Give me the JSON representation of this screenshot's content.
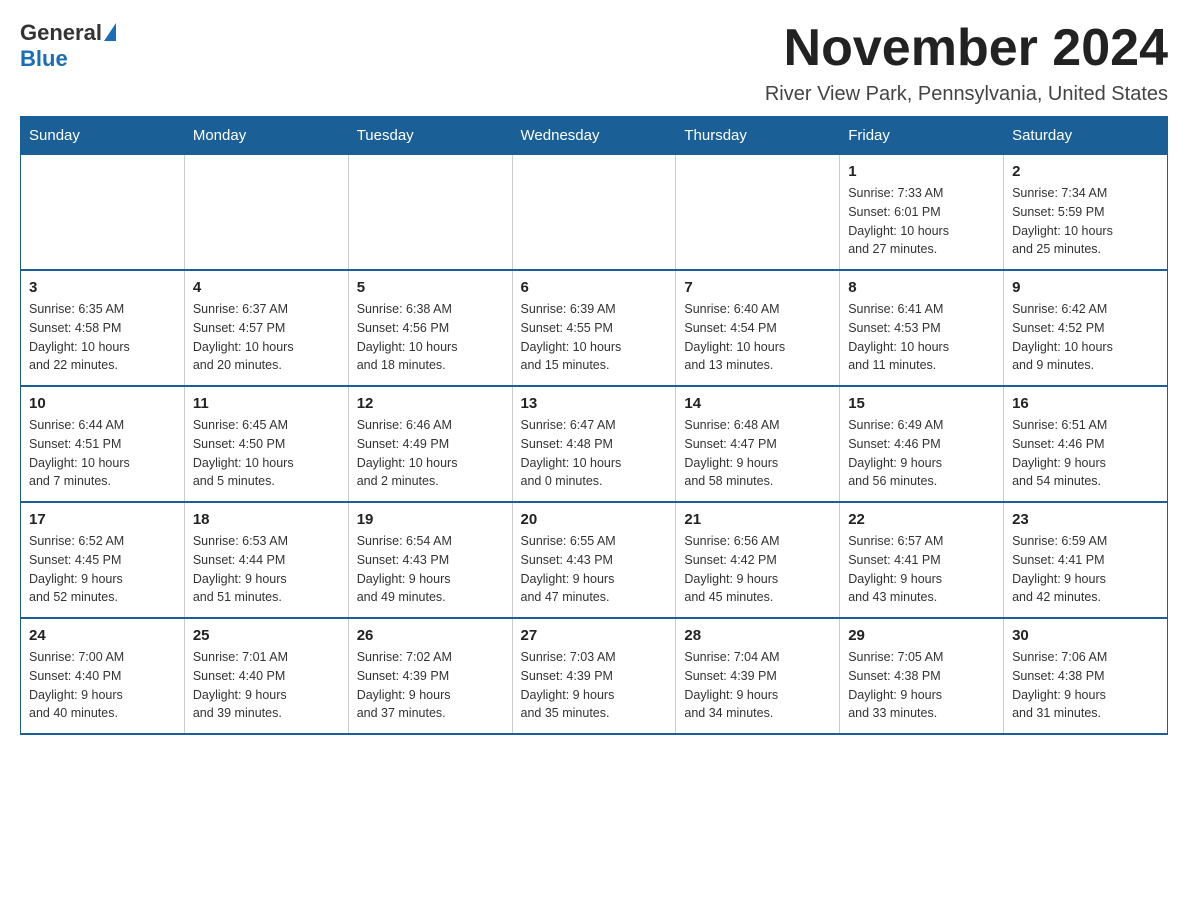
{
  "header": {
    "logo_general": "General",
    "logo_blue": "Blue",
    "title": "November 2024",
    "subtitle": "River View Park, Pennsylvania, United States"
  },
  "weekdays": [
    "Sunday",
    "Monday",
    "Tuesday",
    "Wednesday",
    "Thursday",
    "Friday",
    "Saturday"
  ],
  "weeks": [
    [
      {
        "day": "",
        "info": ""
      },
      {
        "day": "",
        "info": ""
      },
      {
        "day": "",
        "info": ""
      },
      {
        "day": "",
        "info": ""
      },
      {
        "day": "",
        "info": ""
      },
      {
        "day": "1",
        "info": "Sunrise: 7:33 AM\nSunset: 6:01 PM\nDaylight: 10 hours\nand 27 minutes."
      },
      {
        "day": "2",
        "info": "Sunrise: 7:34 AM\nSunset: 5:59 PM\nDaylight: 10 hours\nand 25 minutes."
      }
    ],
    [
      {
        "day": "3",
        "info": "Sunrise: 6:35 AM\nSunset: 4:58 PM\nDaylight: 10 hours\nand 22 minutes."
      },
      {
        "day": "4",
        "info": "Sunrise: 6:37 AM\nSunset: 4:57 PM\nDaylight: 10 hours\nand 20 minutes."
      },
      {
        "day": "5",
        "info": "Sunrise: 6:38 AM\nSunset: 4:56 PM\nDaylight: 10 hours\nand 18 minutes."
      },
      {
        "day": "6",
        "info": "Sunrise: 6:39 AM\nSunset: 4:55 PM\nDaylight: 10 hours\nand 15 minutes."
      },
      {
        "day": "7",
        "info": "Sunrise: 6:40 AM\nSunset: 4:54 PM\nDaylight: 10 hours\nand 13 minutes."
      },
      {
        "day": "8",
        "info": "Sunrise: 6:41 AM\nSunset: 4:53 PM\nDaylight: 10 hours\nand 11 minutes."
      },
      {
        "day": "9",
        "info": "Sunrise: 6:42 AM\nSunset: 4:52 PM\nDaylight: 10 hours\nand 9 minutes."
      }
    ],
    [
      {
        "day": "10",
        "info": "Sunrise: 6:44 AM\nSunset: 4:51 PM\nDaylight: 10 hours\nand 7 minutes."
      },
      {
        "day": "11",
        "info": "Sunrise: 6:45 AM\nSunset: 4:50 PM\nDaylight: 10 hours\nand 5 minutes."
      },
      {
        "day": "12",
        "info": "Sunrise: 6:46 AM\nSunset: 4:49 PM\nDaylight: 10 hours\nand 2 minutes."
      },
      {
        "day": "13",
        "info": "Sunrise: 6:47 AM\nSunset: 4:48 PM\nDaylight: 10 hours\nand 0 minutes."
      },
      {
        "day": "14",
        "info": "Sunrise: 6:48 AM\nSunset: 4:47 PM\nDaylight: 9 hours\nand 58 minutes."
      },
      {
        "day": "15",
        "info": "Sunrise: 6:49 AM\nSunset: 4:46 PM\nDaylight: 9 hours\nand 56 minutes."
      },
      {
        "day": "16",
        "info": "Sunrise: 6:51 AM\nSunset: 4:46 PM\nDaylight: 9 hours\nand 54 minutes."
      }
    ],
    [
      {
        "day": "17",
        "info": "Sunrise: 6:52 AM\nSunset: 4:45 PM\nDaylight: 9 hours\nand 52 minutes."
      },
      {
        "day": "18",
        "info": "Sunrise: 6:53 AM\nSunset: 4:44 PM\nDaylight: 9 hours\nand 51 minutes."
      },
      {
        "day": "19",
        "info": "Sunrise: 6:54 AM\nSunset: 4:43 PM\nDaylight: 9 hours\nand 49 minutes."
      },
      {
        "day": "20",
        "info": "Sunrise: 6:55 AM\nSunset: 4:43 PM\nDaylight: 9 hours\nand 47 minutes."
      },
      {
        "day": "21",
        "info": "Sunrise: 6:56 AM\nSunset: 4:42 PM\nDaylight: 9 hours\nand 45 minutes."
      },
      {
        "day": "22",
        "info": "Sunrise: 6:57 AM\nSunset: 4:41 PM\nDaylight: 9 hours\nand 43 minutes."
      },
      {
        "day": "23",
        "info": "Sunrise: 6:59 AM\nSunset: 4:41 PM\nDaylight: 9 hours\nand 42 minutes."
      }
    ],
    [
      {
        "day": "24",
        "info": "Sunrise: 7:00 AM\nSunset: 4:40 PM\nDaylight: 9 hours\nand 40 minutes."
      },
      {
        "day": "25",
        "info": "Sunrise: 7:01 AM\nSunset: 4:40 PM\nDaylight: 9 hours\nand 39 minutes."
      },
      {
        "day": "26",
        "info": "Sunrise: 7:02 AM\nSunset: 4:39 PM\nDaylight: 9 hours\nand 37 minutes."
      },
      {
        "day": "27",
        "info": "Sunrise: 7:03 AM\nSunset: 4:39 PM\nDaylight: 9 hours\nand 35 minutes."
      },
      {
        "day": "28",
        "info": "Sunrise: 7:04 AM\nSunset: 4:39 PM\nDaylight: 9 hours\nand 34 minutes."
      },
      {
        "day": "29",
        "info": "Sunrise: 7:05 AM\nSunset: 4:38 PM\nDaylight: 9 hours\nand 33 minutes."
      },
      {
        "day": "30",
        "info": "Sunrise: 7:06 AM\nSunset: 4:38 PM\nDaylight: 9 hours\nand 31 minutes."
      }
    ]
  ]
}
